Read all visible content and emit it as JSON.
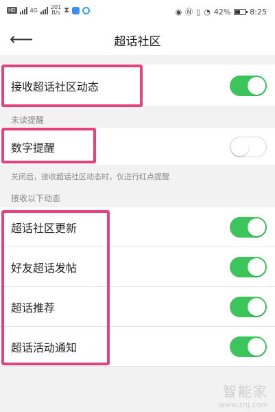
{
  "status_bar": {
    "network_badge": "HD",
    "speed_value": "201",
    "speed_unit": "B/s",
    "signal_label": "4G",
    "battery": "42%",
    "time": "8:25"
  },
  "header": {
    "back_icon": "arrow-left-icon",
    "title": "超话社区"
  },
  "main_setting": {
    "label": "接收超话社区动态",
    "enabled": true
  },
  "unread_section": {
    "header": "未读提醒",
    "label": "数字提醒",
    "enabled": false,
    "hint": "关闭后，接收超话社区动态时，仅进行红点提醒"
  },
  "receive_section": {
    "header": "接收以下动态",
    "items": [
      {
        "label": "超话社区更新",
        "enabled": true
      },
      {
        "label": "好友超话发帖",
        "enabled": true
      },
      {
        "label": "超话推荐",
        "enabled": true
      },
      {
        "label": "超话活动通知",
        "enabled": true
      }
    ]
  },
  "colors": {
    "toggle_on": "#3cc55a",
    "highlight": "#e8407a",
    "background": "#f2f2f2"
  },
  "watermark": {
    "main": "智能家",
    "url": "www.znj.com"
  }
}
